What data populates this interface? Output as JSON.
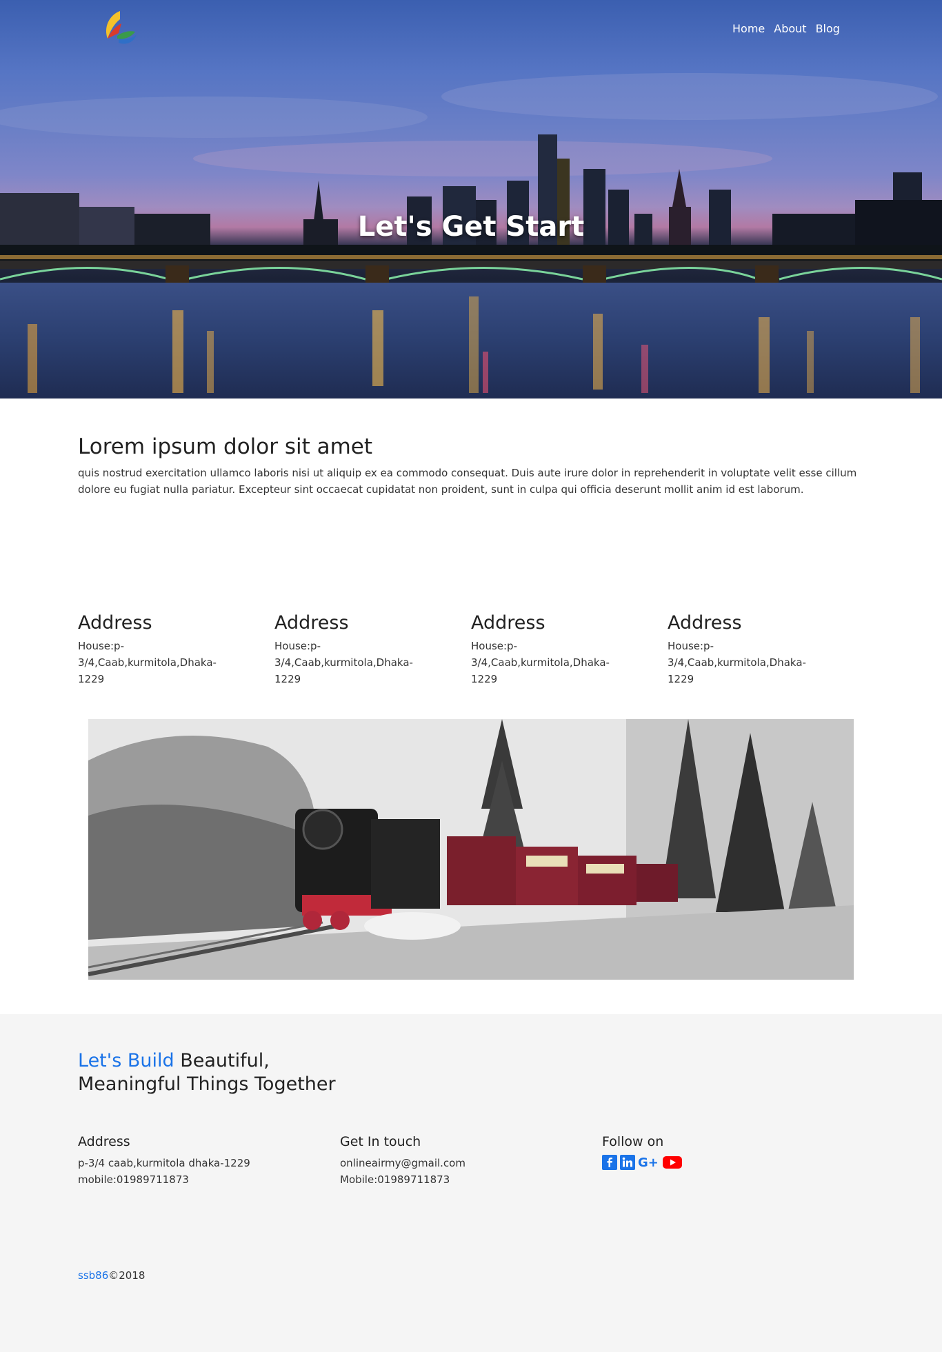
{
  "header": {
    "nav": [
      "Home",
      "About",
      "Blog"
    ]
  },
  "hero": {
    "title": "Let's Get Start"
  },
  "intro": {
    "heading": "Lorem ipsum dolor sit amet",
    "body": "quis nostrud exercitation ullamco laboris nisi ut aliquip ex ea commodo consequat. Duis aute irure dolor in reprehenderit in voluptate velit esse cillum dolore eu fugiat nulla pariatur. Excepteur sint occaecat cupidatat non proident, sunt in culpa qui officia deserunt mollit anim id est laborum."
  },
  "addresses": [
    {
      "title": "Address",
      "line1": "House:p-3/4,Caab,kurmitola,Dhaka-",
      "line2": "1229"
    },
    {
      "title": "Address",
      "line1": "House:p-3/4,Caab,kurmitola,Dhaka-",
      "line2": "1229"
    },
    {
      "title": "Address",
      "line1": "House:p-3/4,Caab,kurmitola,Dhaka-",
      "line2": "1229"
    },
    {
      "title": "Address",
      "line1": "House:p-3/4,Caab,kurmitola,Dhaka-",
      "line2": "1229"
    }
  ],
  "footer": {
    "tagline_accent": "Let's Build",
    "tagline_rest": " Beautiful,",
    "tagline_line2": "Meaningful Things Together",
    "address": {
      "title": "Address",
      "line1": "p-3/4 caab,kurmitola dhaka-1229",
      "line2": "mobile:01989711873"
    },
    "contact": {
      "title": "Get In touch",
      "line1": "onlineairmy@gmail.com",
      "line2": "Mobile:01989711873"
    },
    "follow": {
      "title": "Follow on",
      "icons": [
        "facebook-icon",
        "linkedin-icon",
        "google-plus-icon",
        "youtube-icon"
      ]
    },
    "copyright_link": "ssb86",
    "copyright_text": "©2018"
  },
  "colors": {
    "accent": "#1a73e8",
    "youtube": "#ff0000",
    "footer_bg": "#f5f5f5"
  }
}
